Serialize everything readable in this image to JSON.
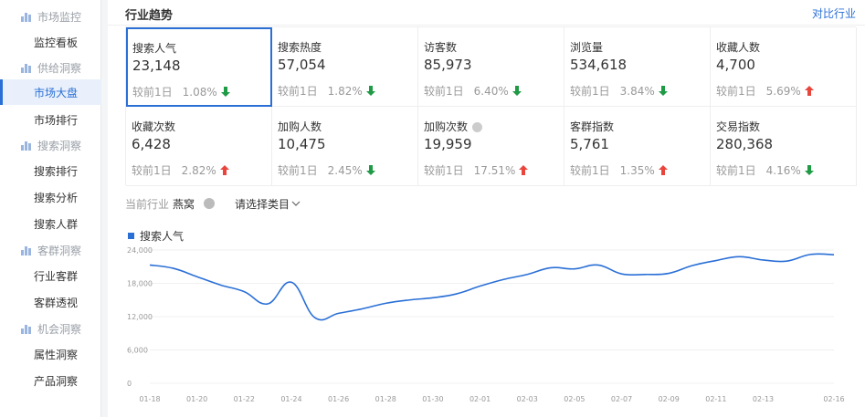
{
  "sidebar": {
    "groups": [
      {
        "label": "市场监控",
        "items": [
          "监控看板"
        ]
      },
      {
        "label": "供给洞察",
        "items": [
          "市场大盘",
          "市场排行"
        ]
      },
      {
        "label": "搜索洞察",
        "items": [
          "搜索排行",
          "搜索分析",
          "搜索人群"
        ]
      },
      {
        "label": "客群洞察",
        "items": [
          "行业客群",
          "客群透视"
        ]
      },
      {
        "label": "机会洞察",
        "items": [
          "属性洞察",
          "产品洞察"
        ]
      }
    ],
    "active": "市场大盘"
  },
  "header": {
    "title": "行业趋势",
    "compare": "对比行业"
  },
  "metrics": [
    {
      "label": "搜索人气",
      "value": "23,148",
      "cmp": "较前1日",
      "pct": "1.08%",
      "dir": "down",
      "selected": true
    },
    {
      "label": "搜索热度",
      "value": "57,054",
      "cmp": "较前1日",
      "pct": "1.82%",
      "dir": "down"
    },
    {
      "label": "访客数",
      "value": "85,973",
      "cmp": "较前1日",
      "pct": "6.40%",
      "dir": "down"
    },
    {
      "label": "浏览量",
      "value": "534,618",
      "cmp": "较前1日",
      "pct": "3.84%",
      "dir": "down"
    },
    {
      "label": "收藏人数",
      "value": "4,700",
      "cmp": "较前1日",
      "pct": "5.69%",
      "dir": "up"
    },
    {
      "label": "收藏次数",
      "value": "6,428",
      "cmp": "较前1日",
      "pct": "2.82%",
      "dir": "up"
    },
    {
      "label": "加购人数",
      "value": "10,475",
      "cmp": "较前1日",
      "pct": "2.45%",
      "dir": "down"
    },
    {
      "label": "加购次数",
      "value": "19,959",
      "cmp": "较前1日",
      "pct": "17.51%",
      "dir": "up",
      "info": true
    },
    {
      "label": "客群指数",
      "value": "5,761",
      "cmp": "较前1日",
      "pct": "1.35%",
      "dir": "up"
    },
    {
      "label": "交易指数",
      "value": "280,368",
      "cmp": "较前1日",
      "pct": "4.16%",
      "dir": "down"
    }
  ],
  "filters": {
    "label": "当前行业",
    "value": "燕窝",
    "select": "请选择类目"
  },
  "colors": {
    "accent": "#2a6fd6",
    "up": "#e8453c",
    "down": "#1f9a45"
  },
  "chart_data": {
    "type": "line",
    "series": [
      {
        "name": "搜索人气",
        "color": "#2a6fd6"
      }
    ],
    "x_ticks": [
      "01-18",
      "01-20",
      "01-22",
      "01-24",
      "01-26",
      "01-28",
      "01-30",
      "02-01",
      "02-03",
      "02-05",
      "02-07",
      "02-09",
      "02-11",
      "02-13",
      "02-16"
    ],
    "y_ticks": [
      "0",
      "6,000",
      "12,000",
      "18,000",
      "24,000"
    ],
    "ylim": [
      0,
      24000
    ],
    "x": [
      "01-18",
      "01-19",
      "01-20",
      "01-21",
      "01-22",
      "01-23",
      "01-24",
      "01-25",
      "01-26",
      "01-27",
      "01-28",
      "01-29",
      "01-30",
      "01-31",
      "02-01",
      "02-02",
      "02-03",
      "02-04",
      "02-05",
      "02-06",
      "02-07",
      "02-08",
      "02-09",
      "02-10",
      "02-11",
      "02-12",
      "02-13",
      "02-14",
      "02-15",
      "02-16"
    ],
    "values": [
      21300,
      20700,
      19200,
      17700,
      16500,
      14300,
      18200,
      11800,
      12600,
      13400,
      14400,
      15000,
      15400,
      16100,
      17500,
      18700,
      19600,
      20800,
      20600,
      21300,
      19700,
      19600,
      19800,
      21200,
      22100,
      22800,
      22200,
      22000,
      23200,
      23148
    ],
    "grid": true,
    "legend": "top-left"
  }
}
